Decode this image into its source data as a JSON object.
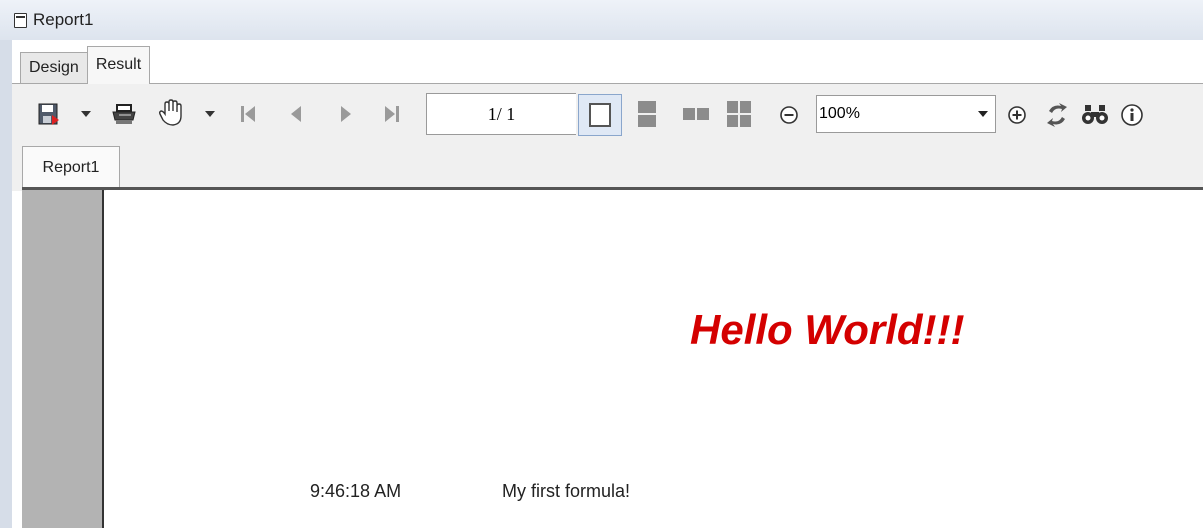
{
  "window": {
    "title": "Report1"
  },
  "tabs": [
    {
      "label": "Design"
    },
    {
      "label": "Result"
    }
  ],
  "toolbar": {
    "page_indicator": "1/ 1",
    "zoom_value": "100%",
    "icons": [
      "save-icon",
      "dropdown-arrow-icon",
      "print-icon",
      "hand-pan-icon",
      "dropdown-arrow-icon",
      "first-page-icon",
      "previous-page-icon",
      "next-page-icon",
      "last-page-icon",
      "single-page-view-icon",
      "continuous-view-icon",
      "two-page-view-icon",
      "multi-page-view-icon",
      "zoom-out-icon",
      "zoom-in-icon",
      "refresh-icon",
      "find-binoculars-icon",
      "info-icon"
    ]
  },
  "report_tabs": [
    {
      "label": "Report1"
    }
  ],
  "report": {
    "heading": "Hello World!!!",
    "time": "9:46:18 AM",
    "formula_text": "My first formula!"
  },
  "colors": {
    "heading": "#d40000",
    "gutter": "#b3b3b3",
    "toolbar": "#f0f0f0"
  }
}
